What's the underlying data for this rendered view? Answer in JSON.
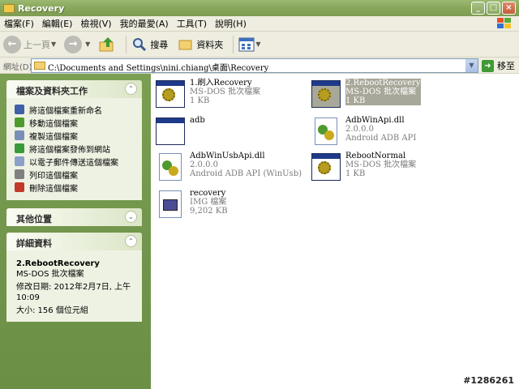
{
  "window": {
    "title": "Recovery",
    "min": "_",
    "max": "□",
    "close": "×"
  },
  "menu": [
    "檔案(F)",
    "編輯(E)",
    "檢視(V)",
    "我的最愛(A)",
    "工具(T)",
    "說明(H)"
  ],
  "toolbar": {
    "back": "上一頁",
    "search": "搜尋",
    "folders": "資料夾"
  },
  "address": {
    "label": "網址(D)",
    "path": "C:\\Documents and Settings\\nini.chiang\\桌面\\Recovery",
    "go": "移至"
  },
  "tasks_panel": {
    "title": "檔案及資料夾工作",
    "items": [
      {
        "label": "將這個檔案重新命名",
        "color": "#3f5fa8"
      },
      {
        "label": "移動這個檔案",
        "color": "#4e9a2e"
      },
      {
        "label": "複製這個檔案",
        "color": "#7a8fb8"
      },
      {
        "label": "將這個檔案發佈到網站",
        "color": "#3a9a3a"
      },
      {
        "label": "以電子郵件傳送這個檔案",
        "color": "#8aa0c8"
      },
      {
        "label": "列印這個檔案",
        "color": "#808080"
      },
      {
        "label": "刪除這個檔案",
        "color": "#c23a2a"
      }
    ]
  },
  "other_panel": {
    "title": "其他位置"
  },
  "details_panel": {
    "title": "詳細資料",
    "name": "2.RebootRecovery",
    "type": "MS-DOS 批次檔案",
    "modified": "修改日期: 2012年2月7日, 上午 10:09",
    "size": "大小: 156 個位元組"
  },
  "files": [
    {
      "name": "1.刷入Recovery",
      "line2": "MS-DOS 批次檔案",
      "line3": "1 KB",
      "icon": "batch-file-icon",
      "selected": false
    },
    {
      "name": "2.RebootRecovery",
      "line2": "MS-DOS 批次檔案",
      "line3": "1 KB",
      "icon": "batch-file-icon",
      "selected": true
    },
    {
      "name": "adb",
      "line2": "",
      "line3": "",
      "icon": "application-icon",
      "selected": false
    },
    {
      "name": "AdbWinApi.dll",
      "line2": "2.0.0.0",
      "line3": "Android ADB API",
      "icon": "dll-file-icon",
      "selected": false
    },
    {
      "name": "AdbWinUsbApi.dll",
      "line2": "2.0.0.0",
      "line3": "Android ADB API (WinUsb)",
      "icon": "dll-file-icon",
      "selected": false
    },
    {
      "name": "RebootNormal",
      "line2": "MS-DOS 批次檔案",
      "line3": "1 KB",
      "icon": "batch-file-icon",
      "selected": false
    },
    {
      "name": "recovery",
      "line2": "IMG 檔案",
      "line3": "9,202 KB",
      "icon": "img-file-icon",
      "selected": false
    }
  ],
  "watermark": "#1286261"
}
